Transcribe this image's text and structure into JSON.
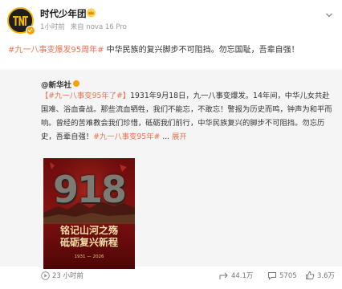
{
  "account": {
    "name": "时代少年团",
    "time": "1小时前",
    "device": "来自 nova 16 Pro"
  },
  "post": {
    "hashtag": "#九一八事变爆发95周年#",
    "text": " 中华民族的复兴脚步不可阻挡。勿忘国耻，吾辈自强！"
  },
  "repost": {
    "author": "@新华社",
    "hashtag1": "【#九一八事变95年了#】",
    "text1": "1931年9月18日，九一八事变爆发。14年间，中华儿女共赴国难、浴血奋战。那些流血牺牲，我们不能忘，不敢忘！警报为历史而鸣，钟声为和平而响。曾经的苦难教会我们珍惜，砥砺我们前行，中华民族复兴的脚步不可阻挡。勿忘历史，吾辈自强！",
    "hashtag2": "#九一八事变95年#",
    "ellipsis": " ...",
    "expand": "展开",
    "poster": {
      "big_text": "918",
      "line1": "铭记山河之殇",
      "line2": "砥砺复兴新程",
      "years": "1931 — 2026"
    }
  },
  "footer": {
    "time": "23 小时前",
    "shares": "44.1万",
    "comments": "5705",
    "likes": "3.6万"
  },
  "colors": {
    "accent": "#eb7350",
    "verified": "#f7a100",
    "poster_red": "#8a1212",
    "poster_gold": "#f4dfa7"
  },
  "icons": [
    "avatar",
    "verified-badge-icon",
    "crown-icon",
    "chevron-down-icon",
    "play-icon",
    "share-icon",
    "comment-icon",
    "like-icon"
  ]
}
